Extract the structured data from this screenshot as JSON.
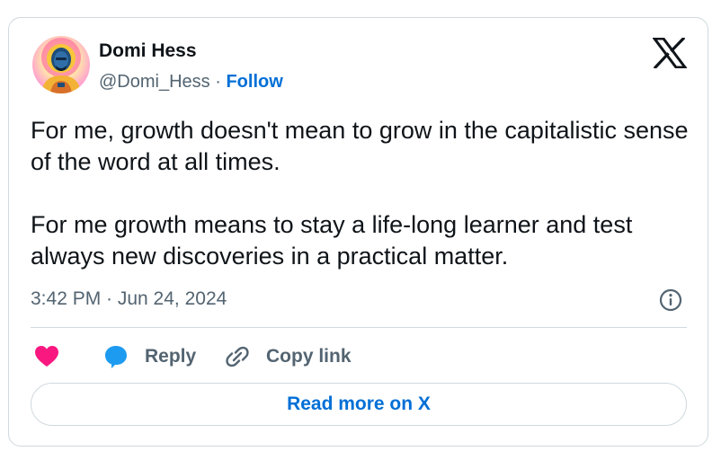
{
  "author": {
    "name": "Domi Hess",
    "handle": "@Domi_Hess",
    "separator": " · ",
    "follow_label": "Follow"
  },
  "tweet": {
    "paragraphs": [
      "For me, growth doesn't mean to grow in the capitalistic sense of the word at all times.",
      "For me growth means to stay a life-long learner and test always new discoveries in a practical matter."
    ],
    "timestamp": "3:42 PM · Jun 24, 2024"
  },
  "actions": {
    "reply_label": "Reply",
    "copy_link_label": "Copy link"
  },
  "read_more_label": "Read more on X",
  "colors": {
    "link_blue": "#006fd6",
    "like_pink": "#f91880",
    "reply_blue": "#1d9bf0",
    "muted_text": "#536471",
    "border": "#cfd9de"
  },
  "icons": {
    "platform": "x-logo-icon",
    "info": "info-icon",
    "like": "heart-icon",
    "reply": "speech-bubble-icon",
    "copy_link": "link-icon"
  }
}
